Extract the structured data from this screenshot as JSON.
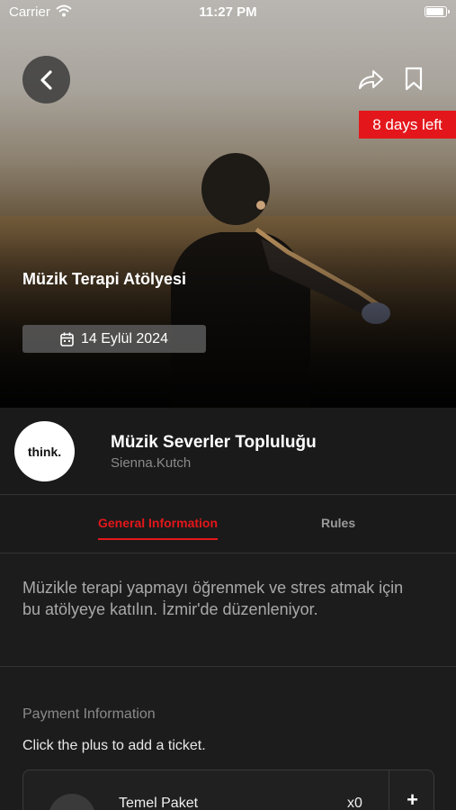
{
  "status_bar": {
    "carrier": "Carrier",
    "time": "11:27 PM"
  },
  "event": {
    "title": "Müzik Terapi Atölyesi",
    "date": "14 Eylül 2024",
    "days_left": "8 days left",
    "badge_color": "#e3171b"
  },
  "organizer": {
    "logo_text": "think.",
    "name": "Müzik Severler Topluluğu",
    "username": "Sienna.Kutch"
  },
  "tabs": [
    {
      "label": "General Information",
      "active": true
    },
    {
      "label": "Rules",
      "active": false
    }
  ],
  "description": "Müzikle terapi yapmayı öğrenmek ve stres atmak için bu atölyeye katılın. İzmir'de düzenleniyor.",
  "payment": {
    "title": "Payment Information",
    "hint": "Click the plus to add a ticket.",
    "tickets": [
      {
        "name": "Temel Paket",
        "quantity": "x0",
        "add_label": "+"
      }
    ]
  },
  "icons": [
    "back-icon",
    "share-icon",
    "bookmark-icon",
    "calendar-icon",
    "wifi-icon",
    "battery-icon"
  ]
}
